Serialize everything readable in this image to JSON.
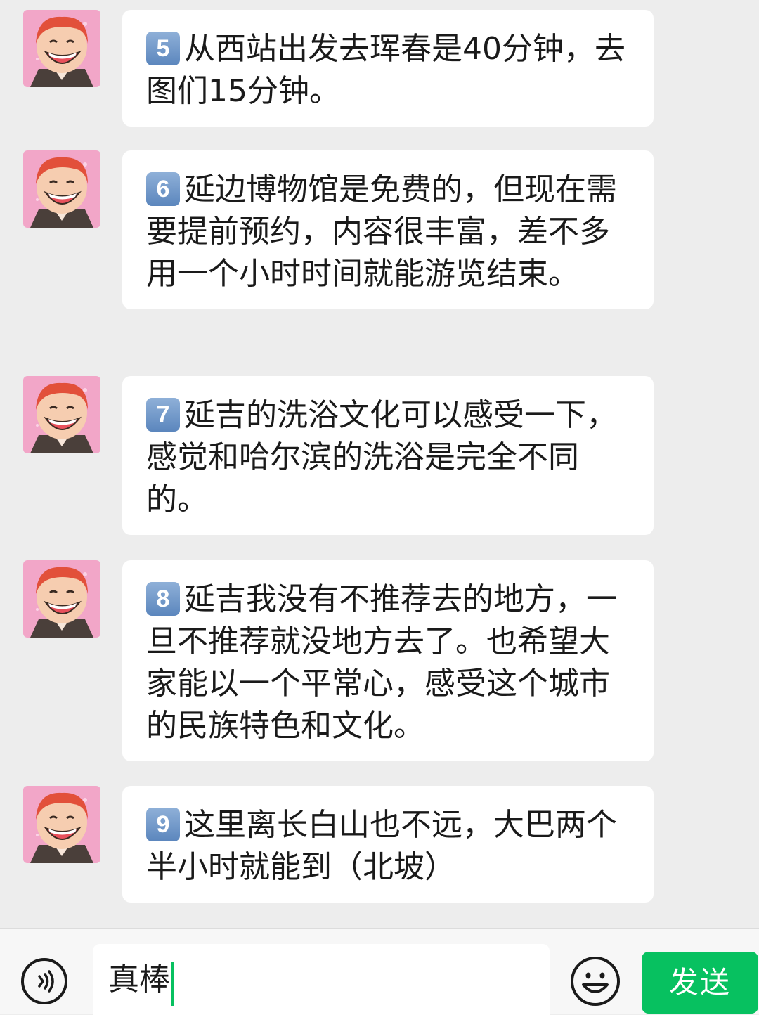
{
  "messages": [
    {
      "badge": "5",
      "text": "从西站出发去珲春是40分钟，去图们15分钟。"
    },
    {
      "badge": "6",
      "text": "延边博物馆是免费的，但现在需要提前预约，内容很丰富，差不多用一个小时时间就能游览结束。"
    },
    {
      "badge": "7",
      "text": "延吉的洗浴文化可以感受一下，感觉和哈尔滨的洗浴是完全不同的。"
    },
    {
      "badge": "8",
      "text": "延吉我没有不推荐去的地方，一旦不推荐就没地方去了。也希望大家能以一个平常心，感受这个城市的民族特色和文化。"
    },
    {
      "badge": "9",
      "text": "这里离长白山也不远，大巴两个半小时就能到（北坡）"
    }
  ],
  "input_bar": {
    "typed_text": "真棒",
    "send_label": "发送",
    "voice_icon": "voice-icon",
    "emoji_icon": "emoji-icon"
  },
  "colors": {
    "accent": "#07c160",
    "background": "#ededed",
    "bubble": "#ffffff"
  }
}
